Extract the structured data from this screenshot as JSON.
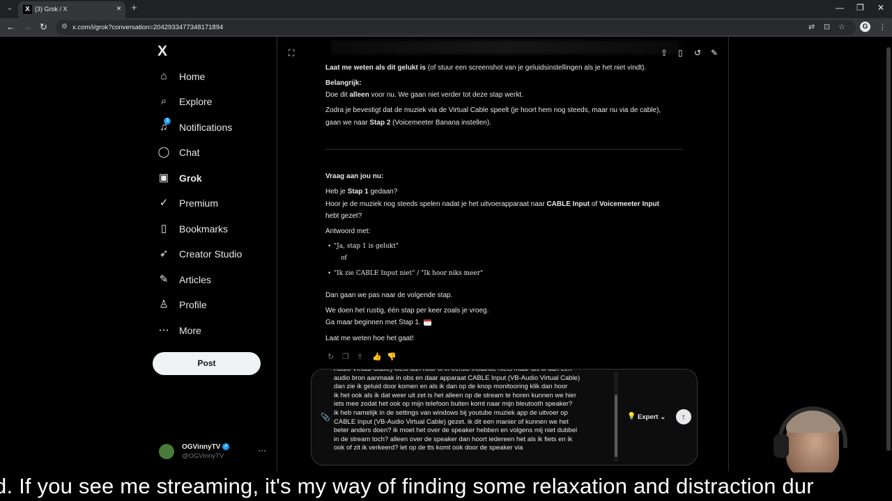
{
  "browser": {
    "tab_title": "(3) Grok / X",
    "url": "x.com/i/grok?conversation=2042933477348171894"
  },
  "sidebar": {
    "logo": "X",
    "items": [
      {
        "label": "Home",
        "icon": "home-icon",
        "glyph": "⌂"
      },
      {
        "label": "Explore",
        "icon": "search-icon",
        "glyph": "⌕"
      },
      {
        "label": "Notifications",
        "icon": "bell-icon",
        "glyph": "🔔",
        "badge": "3"
      },
      {
        "label": "Chat",
        "icon": "chat-icon",
        "glyph": "◯"
      },
      {
        "label": "Grok",
        "icon": "grok-icon",
        "glyph": "▣",
        "active": true
      },
      {
        "label": "Premium",
        "icon": "premium-icon",
        "glyph": "✓"
      },
      {
        "label": "Bookmarks",
        "icon": "bookmark-icon",
        "glyph": "▯"
      },
      {
        "label": "Creator Studio",
        "icon": "rocket-icon",
        "glyph": "➶"
      },
      {
        "label": "Articles",
        "icon": "articles-icon",
        "glyph": "✎"
      },
      {
        "label": "Profile",
        "icon": "person-icon",
        "glyph": "♙"
      },
      {
        "label": "More",
        "icon": "more-circle-icon",
        "glyph": "⋯"
      }
    ],
    "post_label": "Post",
    "account": {
      "name": "OGVinnyTV",
      "handle": "@OGVinnyTV"
    }
  },
  "conversation": {
    "line1_bold": "Laat me weten als dit gelukt is",
    "line1_rest": " (of stuur een screenshot van je geluidsinstellingen als je het niet vindt).",
    "important_label": "Belangrijk:",
    "important_pre": "Doe dit ",
    "important_bold": "alleen",
    "important_post": " voor nu. We gaan niet verder tot deze stap werkt.",
    "confirm_line1": "Zodra je bevestigt dat de muziek via de Virtual Cable speelt (je hoort hem nog steeds, maar nu via de cable),",
    "confirm_line2_pre": "gaan we naar ",
    "confirm_line2_bold": "Stap 2",
    "confirm_line2_post": " (Voicemeeter Banana instellen).",
    "question_label": "Vraag aan jou nu:",
    "q1_pre": "Heb je ",
    "q1_bold": "Stap 1",
    "q1_post": " gedaan?",
    "q2_pre": "Hoor je de muziek nog steeds spelen nadat je het uitvoerapparaat naar ",
    "q2_bold1": "CABLE Input",
    "q2_mid": " of ",
    "q2_bold2": "Voicemeeter Input",
    "q2_end": "hebt gezet?",
    "answer_label": "Antwoord met:",
    "bullet1": "\"Ja, stap 1 is gelukt\"",
    "or_text": "of",
    "bullet2": "\"Ik zie CABLE Input niet\" / \"Ik hoor niks meer\"",
    "next_step": "Dan gaan we pas naar de volgende stap.",
    "calm1": "We doen het rustig, één stap per keer zoals je vroeg.",
    "calm2": "Ga maar beginnen met Stap 1.",
    "let_me_know": "Laat me weten hoe het gaat!"
  },
  "composer": {
    "text": "Audio Virtual Cable)  kiest dan hoor ik in eerste instantie niets maar als ik dan een\naudio bron aanmaak in obs en daar apparaat CABLE Input (VB-Audio Virtual Cable)\ndan zie ik geluid door komen en als ik dan op de knop monitooring klik dan hoor\nik het ook als ik dat weer uit zet is het alleen op de stream te horen kunnen we hier\niets mee zodat het ook op mijn telefoon buiten komt naar mijn bleutooth  speaker?\nik heb namelijk in de settings van windows bij youtube muziek app de uitvoer op\nCABLE Input (VB-Audio Virtual Cable) gezet. ik dit een manier of kunnen we het\nbeter anders doen? ik moet het over de speaker hebben en volgens mij niet dubbel\nin de stream toch? alleen over de speaker dan hoort iedereen het als ik fiets en ik\nook of zit ik verkeerd? let op de tts komt ook door de speaker via",
    "model_label": "Expert"
  },
  "caption": {
    "text": "d. If you see me streaming, it's my way of finding some relaxation and distraction dur"
  },
  "colors": {
    "accent": "#1d9bf0",
    "background": "#000000",
    "text": "#e7e9ea",
    "muted": "#71767b"
  }
}
